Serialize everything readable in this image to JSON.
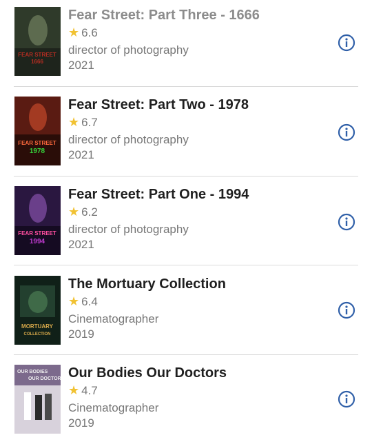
{
  "films": [
    {
      "title": "Fear Street: Part Three - 1666",
      "rating": "6.6",
      "role": "director of photography",
      "year": "2021",
      "title_color": "#8c8c8c",
      "poster": {
        "bg": "#2f3a2a",
        "accent": "#b32d22",
        "line1": "FEAR STREET",
        "line2": "1666"
      }
    },
    {
      "title": "Fear Street: Part Two - 1978",
      "rating": "6.7",
      "role": "director of photography",
      "year": "2021",
      "title_color": "#1f1f1f",
      "poster": {
        "bg": "#5a1b12",
        "accent": "#36d43a",
        "line1": "FEAR STREET",
        "line2": "1978"
      }
    },
    {
      "title": "Fear Street: Part One - 1994",
      "rating": "6.2",
      "role": "director of photography",
      "year": "2021",
      "title_color": "#1f1f1f",
      "poster": {
        "bg": "#2a1740",
        "accent": "#c03bd0",
        "line1": "FEAR STREET",
        "line2": "1994"
      }
    },
    {
      "title": "The Mortuary Collection",
      "rating": "6.4",
      "role": "Cinematographer",
      "year": "2019",
      "title_color": "#1f1f1f",
      "poster": {
        "bg": "#102018",
        "accent": "#d6a84a",
        "line1": "MORTUARY",
        "line2": "COLLECTION"
      }
    },
    {
      "title": "Our Bodies Our Doctors",
      "rating": "4.7",
      "role": "Cinematographer",
      "year": "2019",
      "title_color": "#1f1f1f",
      "poster": {
        "bg": "#7c6a8c",
        "accent": "#f0f0f0",
        "line1": "OUR BODIES",
        "line2": "OUR DOCTORS"
      }
    }
  ],
  "colors": {
    "star": "#f1c232",
    "info": "#2f5fa8",
    "divider": "#d9d9d9"
  },
  "icons": {
    "rating": "star-icon",
    "details": "info-icon"
  }
}
